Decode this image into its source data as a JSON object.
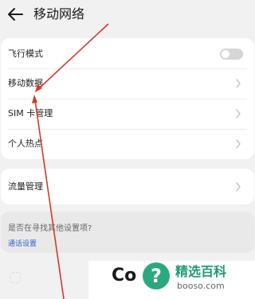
{
  "header": {
    "title": "移动网络",
    "back_icon": "arrow-left-icon"
  },
  "settings_group_1": {
    "items": [
      {
        "label": "飞行模式",
        "control": "toggle",
        "toggle_on": false
      },
      {
        "label": "移动数据",
        "control": "chevron"
      },
      {
        "label": "SIM 卡管理",
        "control": "chevron"
      },
      {
        "label": "个人热点",
        "control": "chevron"
      }
    ]
  },
  "settings_group_2": {
    "items": [
      {
        "label": "流量管理",
        "control": "chevron"
      }
    ]
  },
  "suggestion": {
    "question": "是否在寻找其他设置项?",
    "link": "通话设置"
  },
  "watermark": {
    "partial_text": "Co",
    "badge_glyph": "?",
    "site_name": "精选百科",
    "site_url": "booso.com"
  },
  "colors": {
    "background": "#f1f1f1",
    "card": "#ffffff",
    "link": "#2c5fd0",
    "annotation_arrow": "#d23b2b",
    "watermark_green": "#2aa880"
  }
}
